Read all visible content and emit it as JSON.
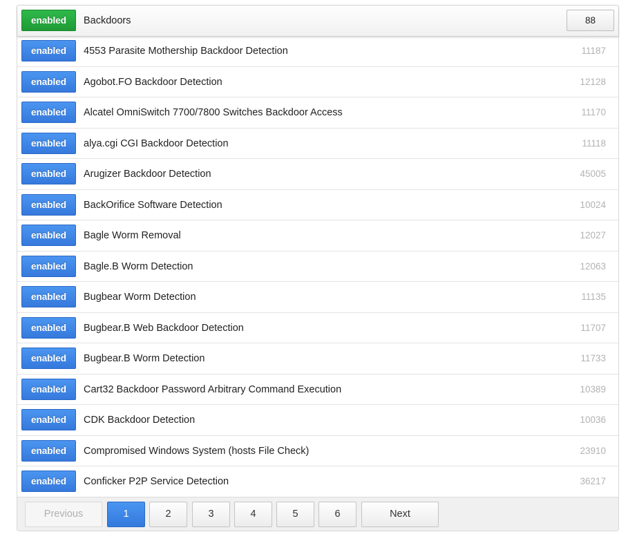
{
  "group": {
    "badge": "enabled",
    "title": "Backdoors",
    "count": "88",
    "colors": {
      "green": "#24a83c",
      "blue": "#3f86e8"
    }
  },
  "rows": [
    {
      "badge": "enabled",
      "name": "4553 Parasite Mothership Backdoor Detection",
      "id": "11187"
    },
    {
      "badge": "enabled",
      "name": "Agobot.FO Backdoor Detection",
      "id": "12128"
    },
    {
      "badge": "enabled",
      "name": "Alcatel OmniSwitch 7700/7800 Switches Backdoor Access",
      "id": "11170"
    },
    {
      "badge": "enabled",
      "name": "alya.cgi CGI Backdoor Detection",
      "id": "11118"
    },
    {
      "badge": "enabled",
      "name": "Arugizer Backdoor Detection",
      "id": "45005"
    },
    {
      "badge": "enabled",
      "name": "BackOrifice Software Detection",
      "id": "10024"
    },
    {
      "badge": "enabled",
      "name": "Bagle Worm Removal",
      "id": "12027"
    },
    {
      "badge": "enabled",
      "name": "Bagle.B Worm Detection",
      "id": "12063"
    },
    {
      "badge": "enabled",
      "name": "Bugbear Worm Detection",
      "id": "11135"
    },
    {
      "badge": "enabled",
      "name": "Bugbear.B Web Backdoor Detection",
      "id": "11707"
    },
    {
      "badge": "enabled",
      "name": "Bugbear.B Worm Detection",
      "id": "11733"
    },
    {
      "badge": "enabled",
      "name": "Cart32 Backdoor Password Arbitrary Command Execution",
      "id": "10389"
    },
    {
      "badge": "enabled",
      "name": "CDK Backdoor Detection",
      "id": "10036"
    },
    {
      "badge": "enabled",
      "name": "Compromised Windows System (hosts File Check)",
      "id": "23910"
    },
    {
      "badge": "enabled",
      "name": "Conficker P2P Service Detection",
      "id": "36217"
    }
  ],
  "pagination": {
    "previous": "Previous",
    "pages": [
      "1",
      "2",
      "3",
      "4",
      "5",
      "6"
    ],
    "active_page": "1",
    "next": "Next"
  }
}
